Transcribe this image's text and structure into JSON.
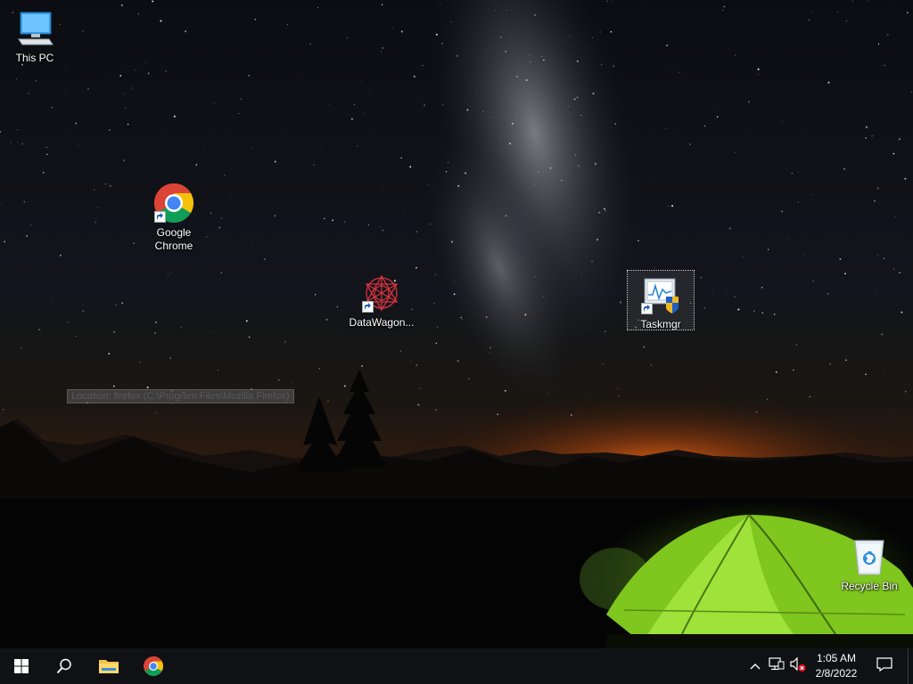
{
  "desktop": {
    "icons": [
      {
        "label": "This PC",
        "icon": "computer-icon"
      },
      {
        "label": "Google Chrome",
        "icon": "chrome-icon"
      },
      {
        "label": "DataWagon...",
        "icon": "datawagon-icon"
      },
      {
        "label": "Taskmgr",
        "icon": "taskmgr-icon",
        "selected": true
      },
      {
        "label": "Recycle Bin",
        "icon": "recycle-bin-icon"
      }
    ],
    "tooltip": "Location: firefox (C:\\Program Files\\Mozilla Firefox)"
  },
  "taskbar": {
    "buttons": [
      {
        "name": "Start",
        "icon": "windows-start-icon"
      },
      {
        "name": "Search",
        "icon": "search-icon"
      },
      {
        "name": "File Explorer",
        "icon": "folder-icon"
      },
      {
        "name": "Google Chrome",
        "icon": "chrome-icon"
      }
    ],
    "tray": {
      "icons": [
        "chevron-up-icon",
        "network-icon",
        "volume-muted-icon"
      ],
      "time": "1:05 AM",
      "date": "2/8/2022"
    },
    "notifications_icon": "action-center-icon"
  },
  "colors": {
    "taskbar_bg": "#101114",
    "tent_green": "#8fd62a",
    "horizon_orange": "#e8701c"
  }
}
